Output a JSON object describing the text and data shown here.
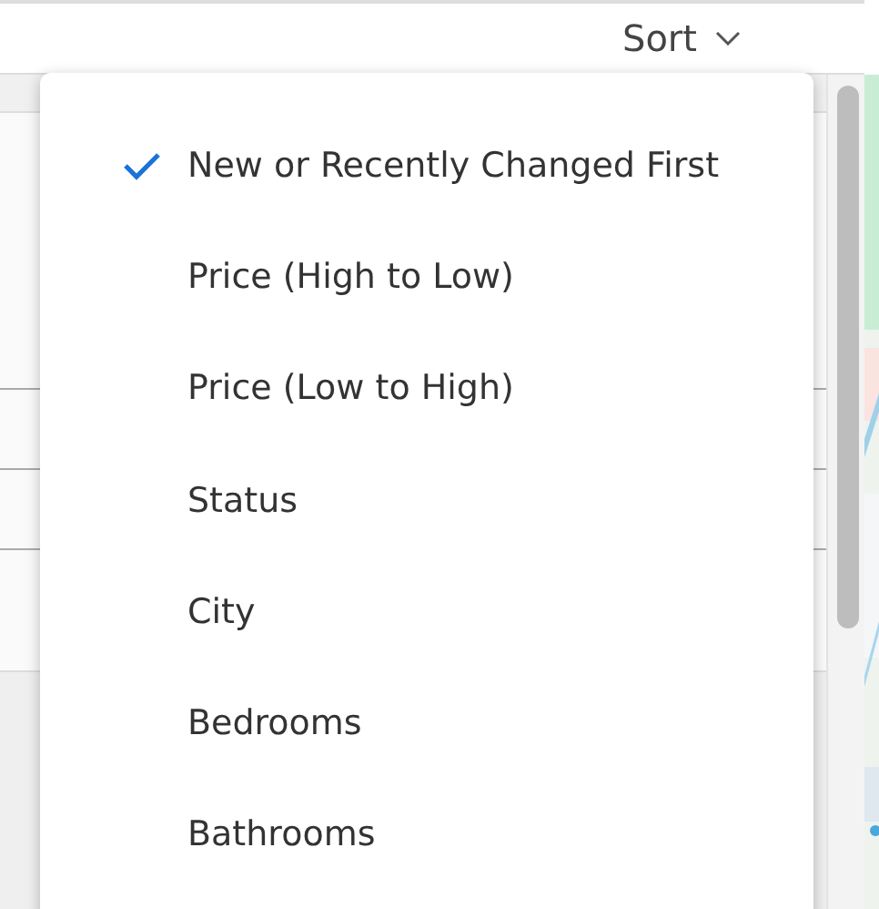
{
  "sort": {
    "label": "Sort"
  },
  "menu": {
    "items": [
      {
        "label": "New or Recently Changed First",
        "selected": true
      },
      {
        "label": "Price (High to Low)",
        "selected": false
      },
      {
        "label": "Price (Low to High)",
        "selected": false
      },
      {
        "label": "Status",
        "selected": false
      },
      {
        "label": "City",
        "selected": false
      },
      {
        "label": "Bedrooms",
        "selected": false
      },
      {
        "label": "Bathrooms",
        "selected": false
      }
    ]
  }
}
